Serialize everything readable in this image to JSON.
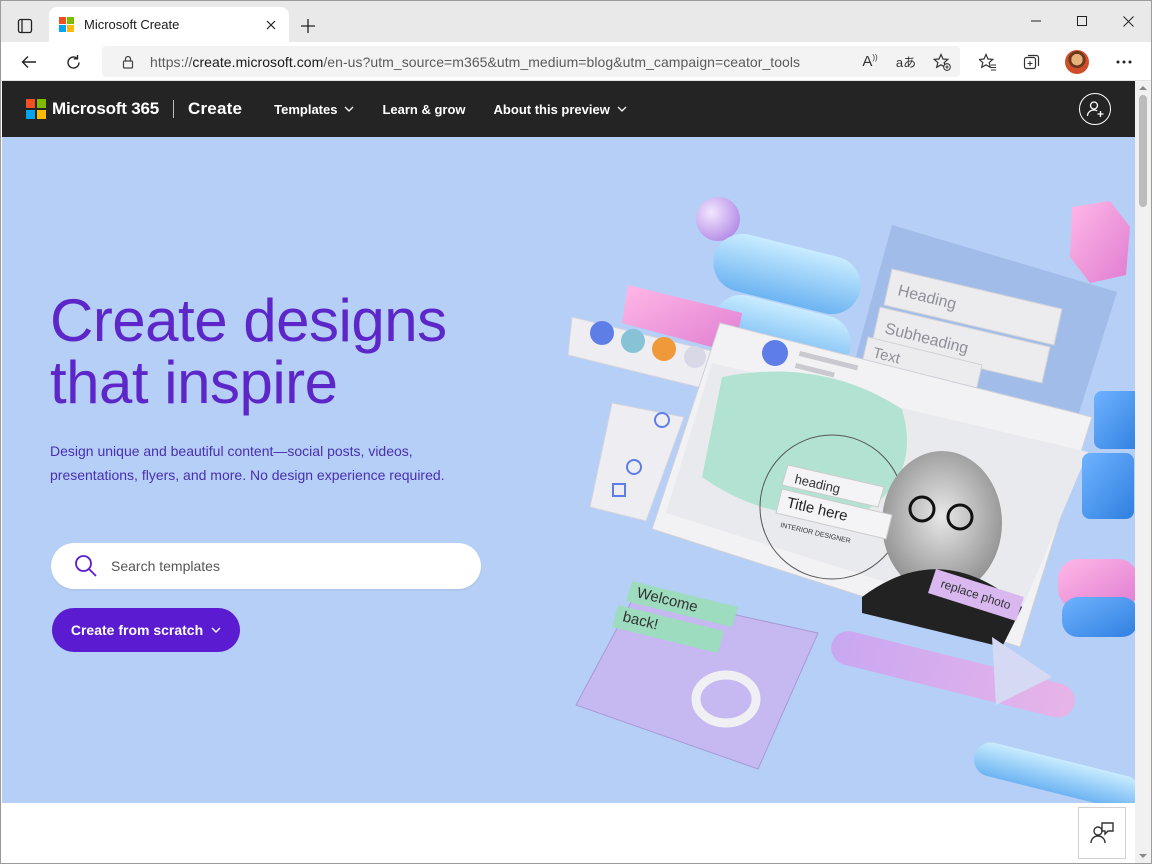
{
  "browser": {
    "tab": {
      "title": "Microsoft Create"
    },
    "url": {
      "prefix": "https://",
      "host": "create.microsoft.com",
      "path": "/en-us?utm_source=m365&utm_medium=blog&utm_campaign=ceator_tools"
    },
    "read_aloud_glyph": "A",
    "translate_glyph": "aあ"
  },
  "site": {
    "brand": "Microsoft 365",
    "product": "Create",
    "nav": [
      {
        "label": "Templates"
      },
      {
        "label": "Learn & grow"
      },
      {
        "label": "About this preview"
      }
    ],
    "logo_colors": [
      "#f25022",
      "#7fba00",
      "#00a4ef",
      "#ffb900"
    ]
  },
  "hero": {
    "title_line1": "Create designs",
    "title_line2": "that inspire",
    "description": "Design unique and beautiful content—social posts, videos, presentations, flyers, and more. No design experience required.",
    "search_placeholder": "Search templates",
    "cta_label": "Create from scratch",
    "illustration": {
      "block_heading": "Heading",
      "block_subheading": "Subheading",
      "block_text": "Text",
      "card_heading": "heading",
      "card_title": "Title here",
      "card_role": "INTERIOR DESIGNER",
      "replace_photo": "replace photo",
      "welcome_line1": "Welcome",
      "welcome_line2": "back!"
    }
  },
  "colors": {
    "accent": "#5a1bd1",
    "hero_bg": "#b5cff6",
    "title": "#5d26c9",
    "header_bg": "#242424"
  }
}
